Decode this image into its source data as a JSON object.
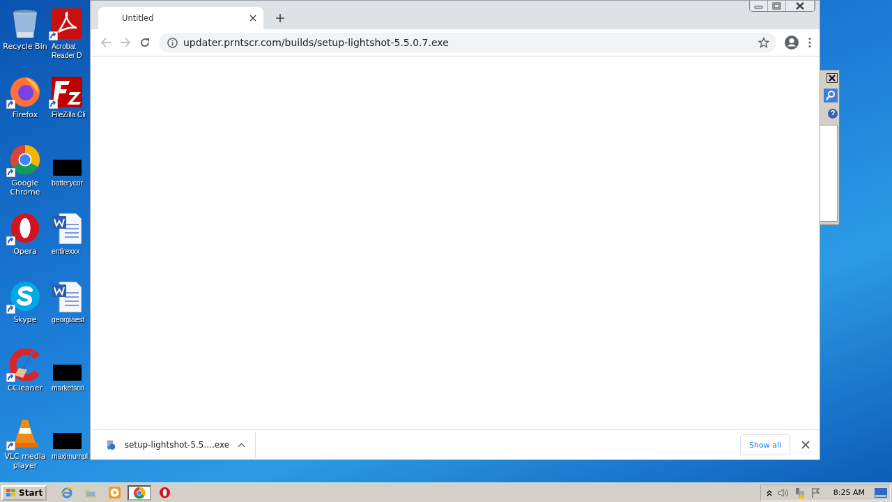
{
  "desktop_icons": [
    {
      "label": "Recycle Bin",
      "kind": "recycle",
      "shortcut": false
    },
    {
      "label": "Acrobat Reader D",
      "kind": "acrobat",
      "shortcut": true
    },
    {
      "label": "Firefox",
      "kind": "firefox",
      "shortcut": true
    },
    {
      "label": "FileZilla Cli",
      "kind": "filezilla",
      "shortcut": true
    },
    {
      "label": "Google Chrome",
      "kind": "chrome",
      "shortcut": true
    },
    {
      "label": "batterycor",
      "kind": "blank",
      "shortcut": false
    },
    {
      "label": "Opera",
      "kind": "opera",
      "shortcut": true
    },
    {
      "label": "entirexxx",
      "kind": "word",
      "shortcut": false
    },
    {
      "label": "Skype",
      "kind": "skype",
      "shortcut": true
    },
    {
      "label": "georgiaest",
      "kind": "word",
      "shortcut": false
    },
    {
      "label": "CCleaner",
      "kind": "ccleaner",
      "shortcut": true
    },
    {
      "label": "marketscri",
      "kind": "blank",
      "shortcut": false
    },
    {
      "label": "VLC media player",
      "kind": "vlc",
      "shortcut": true
    },
    {
      "label": "maximumpl",
      "kind": "blank",
      "shortcut": false
    }
  ],
  "browser": {
    "tab": {
      "title": "Untitled"
    },
    "url": "updater.prntscr.com/builds/setup-lightshot-5.5.0.7.exe",
    "download": {
      "filename": "setup-lightshot-5.5....exe"
    },
    "show_all": "Show all"
  },
  "taskbar": {
    "start": "Start",
    "apps": [
      {
        "kind": "ie",
        "selected": false
      },
      {
        "kind": "folder",
        "selected": false
      },
      {
        "kind": "media",
        "selected": false
      },
      {
        "kind": "chrome",
        "selected": true
      },
      {
        "kind": "opera",
        "selected": false
      }
    ],
    "clock": "8:25 AM"
  }
}
